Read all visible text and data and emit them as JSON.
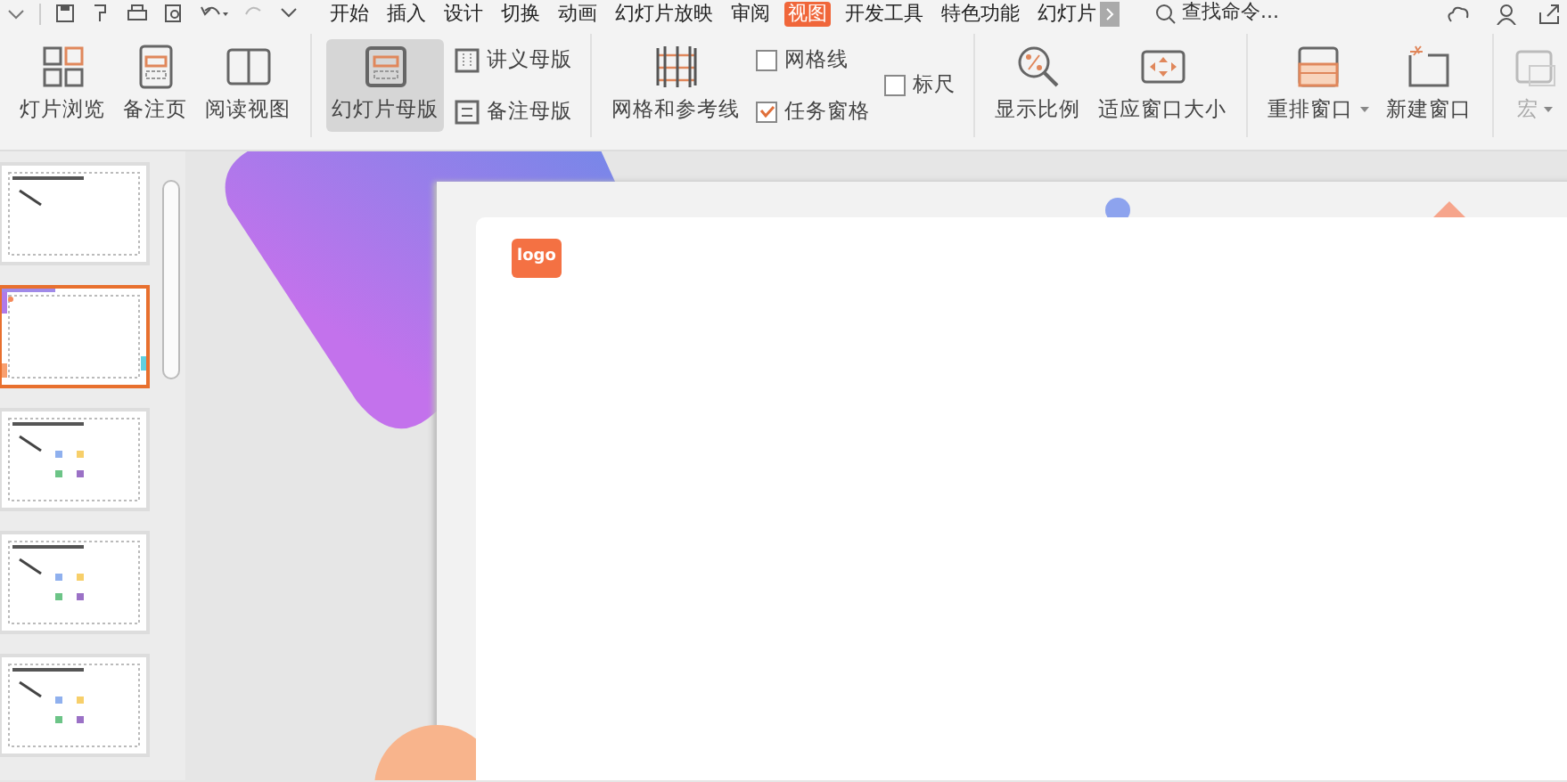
{
  "menu_tabs": [
    {
      "label": "开始",
      "selected": false
    },
    {
      "label": "插入",
      "selected": false
    },
    {
      "label": "设计",
      "selected": false
    },
    {
      "label": "切换",
      "selected": false
    },
    {
      "label": "动画",
      "selected": false
    },
    {
      "label": "幻灯片放映",
      "selected": false
    },
    {
      "label": "审阅",
      "selected": false
    },
    {
      "label": "视图",
      "selected": true
    },
    {
      "label": "开发工具",
      "selected": false
    },
    {
      "label": "特色功能",
      "selected": false
    },
    {
      "label": "幻灯片",
      "selected": false
    }
  ],
  "search": {
    "placeholder": "查找命令..."
  },
  "ribbon": [
    {
      "columns": [
        [
          {
            "kind": "large",
            "label": "灯片浏览",
            "selected": false
          }
        ],
        [
          {
            "kind": "large",
            "label": "备注页",
            "selected": false
          }
        ],
        [
          {
            "kind": "large",
            "label": "阅读视图",
            "selected": false
          }
        ]
      ]
    },
    {
      "columns": [
        [
          {
            "kind": "large",
            "label": "幻灯片母版",
            "selected": true
          }
        ],
        [
          {
            "kind": "small",
            "label": "讲义母版"
          },
          {
            "kind": "small",
            "label": "备注母版"
          }
        ]
      ]
    },
    {
      "columns": [
        [
          {
            "kind": "large",
            "label": "网格和参考线",
            "selected": false
          }
        ],
        [
          {
            "kind": "check",
            "label": "网格线",
            "checked": false
          },
          {
            "kind": "check",
            "label": "任务窗格",
            "checked": true
          }
        ],
        [
          {
            "kind": "check",
            "label": "标尺",
            "checked": false
          }
        ]
      ]
    },
    {
      "columns": [
        [
          {
            "kind": "large",
            "label": "显示比例",
            "selected": false
          }
        ],
        [
          {
            "kind": "large",
            "label": "适应窗口大小",
            "selected": false
          }
        ]
      ]
    },
    {
      "columns": [
        [
          {
            "kind": "large",
            "label": "重排窗口",
            "selected": false,
            "dropdown": true
          }
        ],
        [
          {
            "kind": "large",
            "label": "新建窗口",
            "selected": false
          }
        ]
      ]
    },
    {
      "columns": [
        [
          {
            "kind": "large",
            "label": "宏",
            "selected": false,
            "dropdown": true,
            "disabled": true
          }
        ]
      ]
    }
  ],
  "slides": [
    {
      "selected": false
    },
    {
      "selected": true
    },
    {
      "selected": false
    },
    {
      "selected": false
    },
    {
      "selected": false
    }
  ],
  "slide": {
    "logo": "logo"
  }
}
